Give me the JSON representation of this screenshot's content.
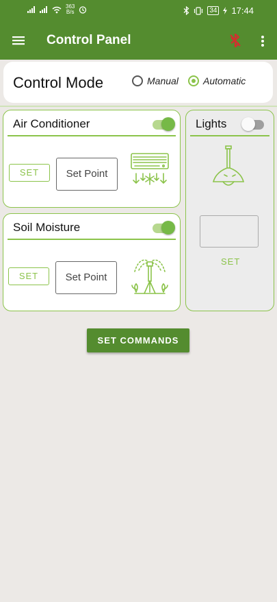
{
  "status_bar": {
    "speed_value": "363",
    "speed_unit": "B/s",
    "battery": "34",
    "time": "17:44"
  },
  "app_bar": {
    "title": "Control Panel",
    "icons": [
      "menu-icon",
      "bluetooth-disabled-icon",
      "more-vert-icon"
    ],
    "bluetooth_color": "#d32f2f"
  },
  "control_mode": {
    "title": "Control Mode",
    "options": [
      {
        "label": "Manual",
        "selected": false
      },
      {
        "label": "Automatic",
        "selected": true
      }
    ]
  },
  "air_conditioner": {
    "title": "Air Conditioner",
    "enabled": true,
    "set_label": "SET",
    "placeholder": "Set Point",
    "icon": "air-conditioner-icon"
  },
  "soil_moisture": {
    "title": "Soil Moisture",
    "enabled": true,
    "set_label": "SET",
    "placeholder": "Set Point",
    "icon": "sprinkler-icon"
  },
  "lights": {
    "title": "Lights",
    "enabled": false,
    "set_label": "SET",
    "icon": "ceiling-lamp-icon"
  },
  "commands_button": "SET COMMANDS",
  "colors": {
    "primary": "#548c2f",
    "accent": "#8bc34a",
    "background": "#ece9e6"
  }
}
